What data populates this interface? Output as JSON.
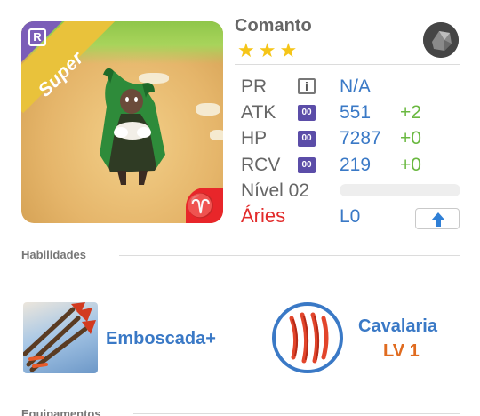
{
  "card": {
    "badge_text": "Super",
    "rarity_letter": "R",
    "zodiac_symbol": "♈",
    "stars": [
      "★",
      "★",
      "★"
    ]
  },
  "header": {
    "name": "Comanto",
    "element_icon": "stone-element-icon"
  },
  "stats": [
    {
      "label": "PR",
      "icon": "info-icon",
      "icon_text": "i",
      "value": "N/A",
      "bonus": ""
    },
    {
      "label": "ATK",
      "icon": "stat-chip-icon",
      "icon_text": "00",
      "value": "551",
      "bonus": "+2"
    },
    {
      "label": "HP",
      "icon": "stat-chip-icon",
      "icon_text": "00",
      "value": "7287",
      "bonus": "+0"
    },
    {
      "label": "RCV",
      "icon": "stat-chip-icon",
      "icon_text": "00",
      "value": "219",
      "bonus": "+0"
    }
  ],
  "level": {
    "label": "Nível 02",
    "progress": 0
  },
  "zodiac": {
    "label": "Áries",
    "value": "L0",
    "upgrade_icon": "arrow-up-icon"
  },
  "sections": {
    "skills_title": "Habilidades",
    "equipment_title": "Equipamentos"
  },
  "skills": [
    {
      "name": "Emboscada+",
      "icon": "arrows-skill-icon"
    },
    {
      "name": "Cavalaria",
      "level": "LV 1",
      "icon": "claw-skill-icon"
    }
  ],
  "colors": {
    "accent_blue": "#3a79c6",
    "bonus_green": "#6ab840",
    "zodiac_red": "#e22b2b",
    "banner_yellow": "#e9c23b",
    "rarity_purple": "#7b5db8",
    "skill_level_orange": "#e06b1f"
  }
}
